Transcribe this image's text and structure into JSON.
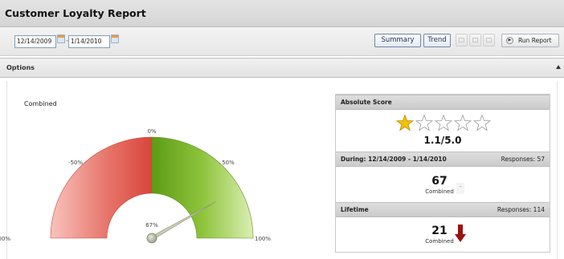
{
  "window": {
    "title": "Customer Loyalty Report"
  },
  "toolbar": {
    "start_date": "12/14/2009",
    "end_date": "1/14/2010",
    "summary_label": "Summary",
    "trend_label": "Trend",
    "run_report_label": "Run Report",
    "icons": [
      "export-icon",
      "save-icon",
      "print-icon",
      "run-icon"
    ]
  },
  "options": {
    "label": "Options"
  },
  "gauge": {
    "title": "Combined",
    "scale_labels": [
      "-100%",
      "-50%",
      "0%",
      "50%",
      "100%"
    ],
    "value_label": "67%",
    "value": 67,
    "colors": {
      "negative": "#d9534f",
      "positive": "#6fa821"
    }
  },
  "score_panel": {
    "absolute": {
      "header": "Absolute Score",
      "score_text": "1.1/5.0",
      "rating": 1.1,
      "max_rating": 5,
      "star_color": "#f2c200"
    },
    "period": {
      "header": "During: 12/14/2009 - 1/14/2010",
      "responses": "Responses: 57",
      "value": "67",
      "caption": "Combined",
      "dash": "–"
    },
    "lifetime": {
      "header": "Lifetime",
      "responses": "Responses: 114",
      "value": "21",
      "caption": "Combined",
      "trend_icon": "down-arrow-icon",
      "trend_color": "#9c1010"
    }
  }
}
